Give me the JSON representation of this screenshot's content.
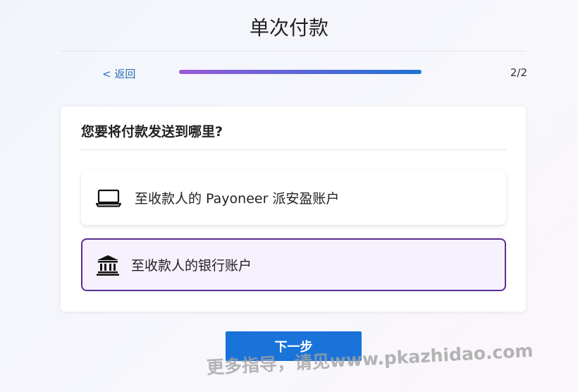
{
  "header": {
    "title": "单次付款"
  },
  "nav": {
    "back_label": "< 返回",
    "step_label": "2/2",
    "progress": 1.0
  },
  "card": {
    "question": "您要将付款发送到哪里?",
    "options": [
      {
        "label": "至收款人的 Payoneer 派安盈账户",
        "icon": "laptop-icon",
        "selected": false
      },
      {
        "label": "至收款人的银行账户",
        "icon": "bank-icon",
        "selected": true
      }
    ]
  },
  "actions": {
    "next_label": "下一步"
  },
  "watermark": "更多指导，请见www.pkazhidao.com",
  "colors": {
    "accent": "#1a73d8",
    "selected_border": "#5a2e91",
    "selected_bg": "#f6f1fc",
    "back_link": "#2d6fb6"
  }
}
